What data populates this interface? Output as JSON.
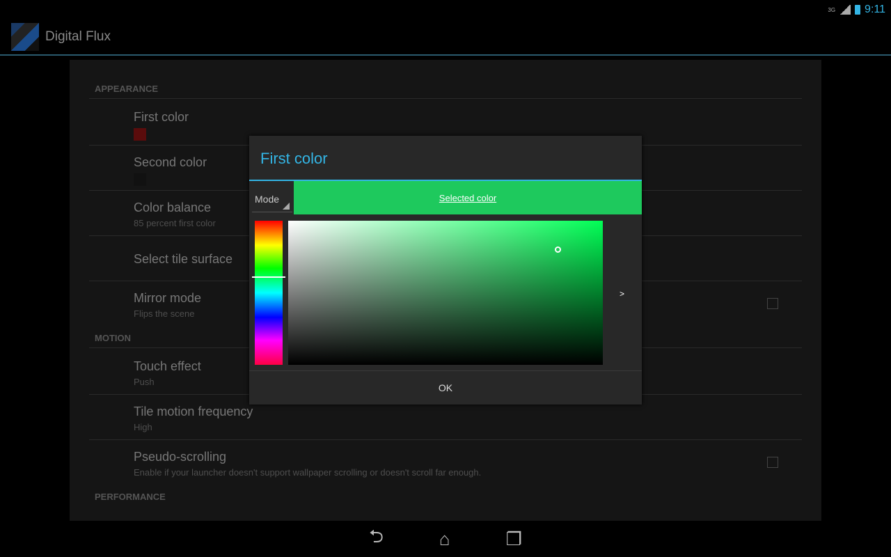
{
  "status": {
    "network": "3G",
    "time": "9:11"
  },
  "app": {
    "title": "Digital Flux"
  },
  "sections": [
    {
      "header": "APPEARANCE"
    },
    {
      "header": "MOTION"
    },
    {
      "header": "PERFORMANCE"
    }
  ],
  "prefs": {
    "first_color": {
      "title": "First color",
      "swatch": "#5a0c0c"
    },
    "second_color": {
      "title": "Second color",
      "swatch": "#111111"
    },
    "color_balance": {
      "title": "Color balance",
      "summary": "85 percent first color"
    },
    "tile_surface": {
      "title": "Select tile surface"
    },
    "mirror": {
      "title": "Mirror mode",
      "summary": "Flips the scene",
      "checked": false
    },
    "touch": {
      "title": "Touch effect",
      "summary": "Push"
    },
    "motion_freq": {
      "title": "Tile motion frequency",
      "summary": "High"
    },
    "pseudo": {
      "title": "Pseudo-scrolling",
      "summary": "Enable if your launcher doesn't support wallpaper scrolling or doesn't scroll far enough.",
      "checked": false
    }
  },
  "dialog": {
    "title": "First color",
    "mode_label": "Mode",
    "selected_label": "Selected color",
    "selected_color": "#1ec95d",
    "hue_deg": 140,
    "saturation": 0.86,
    "value": 0.8,
    "next": ">",
    "ok": "OK"
  }
}
